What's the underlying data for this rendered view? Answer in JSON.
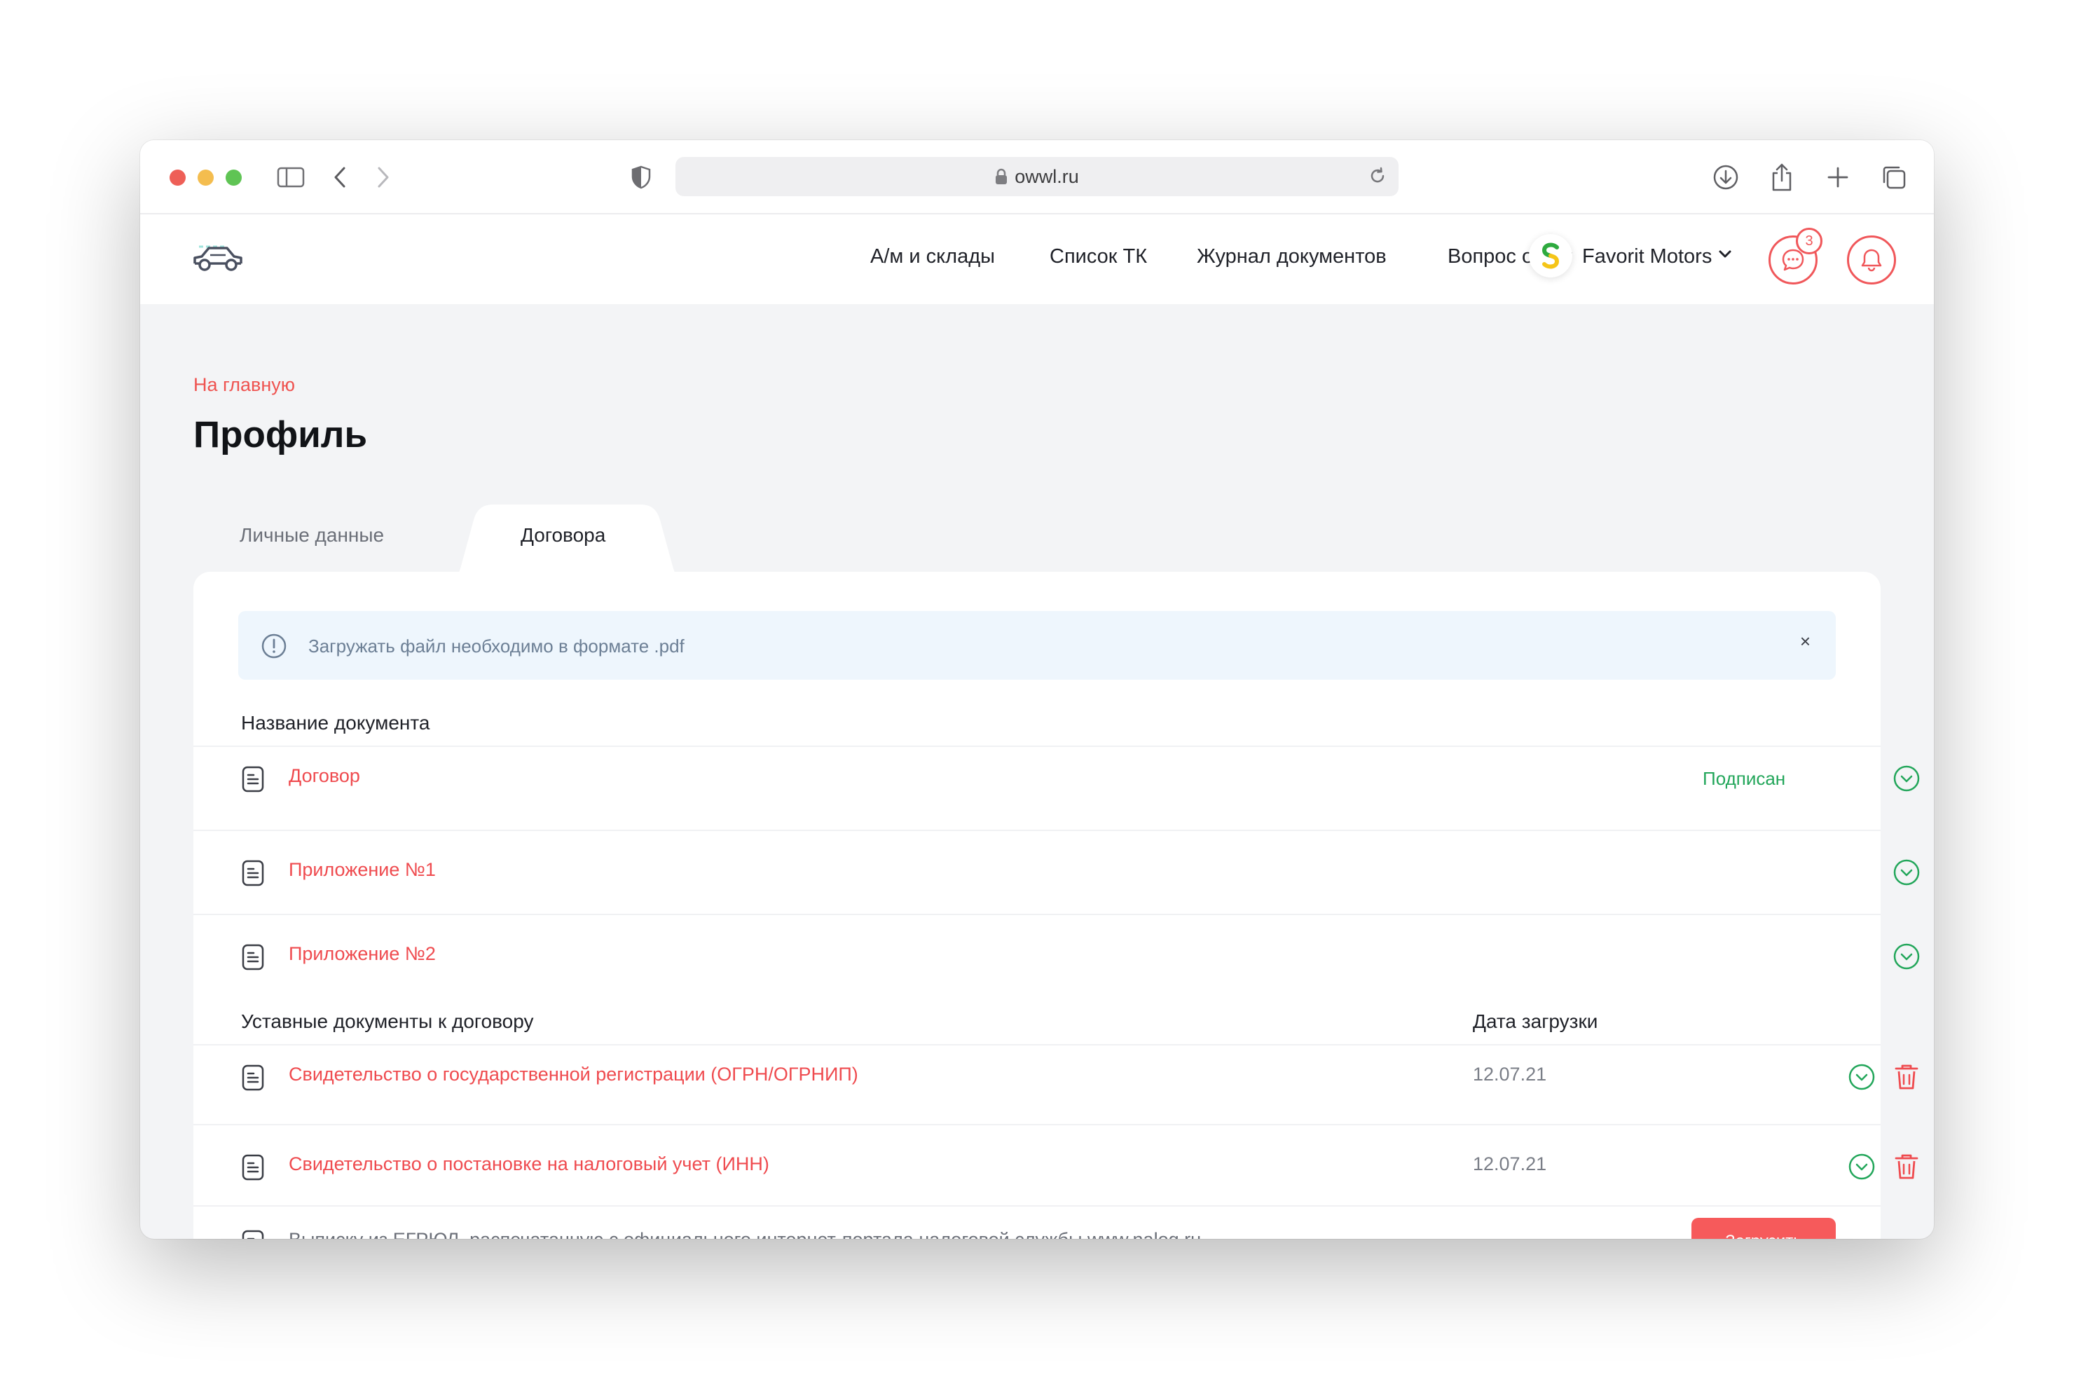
{
  "browser": {
    "url": "owwl.ru"
  },
  "nav": {
    "items": [
      "А/м и склады",
      "Список ТК",
      "Журнал документов",
      "Вопрос ответ"
    ],
    "company": "Favorit Motors",
    "messages_badge": "3"
  },
  "page": {
    "breadcrumb": "На главную",
    "title": "Профиль",
    "tabs": [
      {
        "label": "Личные данные",
        "active": false
      },
      {
        "label": "Договора",
        "active": true
      }
    ]
  },
  "alert": {
    "text": "Загружать файл необходимо в формате .pdf",
    "close": "×"
  },
  "contracts": {
    "header": "Название документа",
    "rows": [
      {
        "name": "Договор",
        "status": "Подписан"
      },
      {
        "name": "Приложение №1",
        "status": ""
      },
      {
        "name": "Приложение №2",
        "status": ""
      }
    ]
  },
  "statutory": {
    "header": "Уставные документы к договору",
    "date_header": "Дата загрузки",
    "rows": [
      {
        "name": "Свидетельство о государственной регистрации (ОГРН/ОГРНИП)",
        "date": "12.07.21"
      },
      {
        "name": "Свидетельство о постановке на налоговый учет (ИНН)",
        "date": "12.07.21"
      },
      {
        "name": "Выписку из ЕГРЮЛ, распечатанную с официального интернет-портала налоговой службы www.nalog.ru",
        "date": ""
      }
    ],
    "upload_label": "Загрузить"
  },
  "colors": {
    "accent": "#ef4b4f",
    "success": "#22a65a",
    "alert_bg": "#eef6fd"
  }
}
